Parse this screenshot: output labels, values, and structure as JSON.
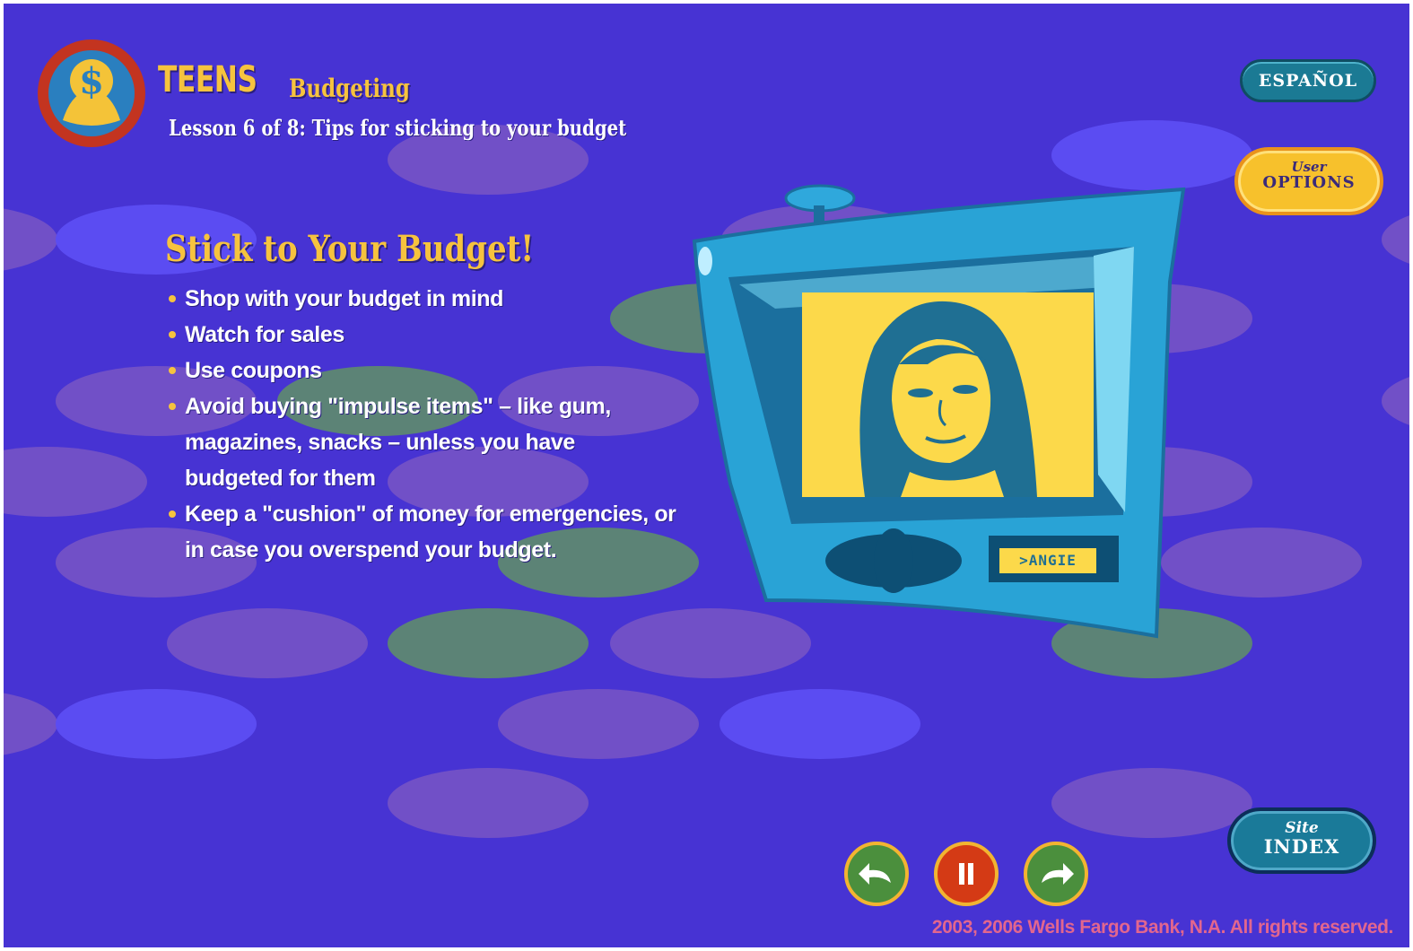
{
  "header": {
    "title": "TEENS",
    "subtitle": "Budgeting",
    "lesson": "Lesson 6 of 8: Tips for sticking to your budget"
  },
  "top_right": {
    "espanol_label": "ESPAÑOL",
    "user_options_small": "User",
    "user_options_big": "OPTIONS"
  },
  "lesson_content": {
    "heading": "Stick to Your Budget!",
    "tips": [
      "Shop with your budget in mind",
      "Watch for sales",
      "Use coupons",
      "Avoid buying \"impulse items\" – like gum, magazines, snacks – unless you have budgeted for them",
      "Keep a \"cushion\" of money for emergencies, or in case you overspend your budget."
    ]
  },
  "tv": {
    "character_label": ">ANGIE"
  },
  "nav": {
    "site_index_small": "Site",
    "site_index_big": "INDEX"
  },
  "footer": {
    "copyright": "2003, 2006 Wells Fargo Bank, N.A. All rights reserved."
  },
  "colors": {
    "background": "#4733d3",
    "accent_yellow": "#f6c33e",
    "tv_blue": "#29a3d6",
    "copyright_pink": "#e2668e"
  }
}
